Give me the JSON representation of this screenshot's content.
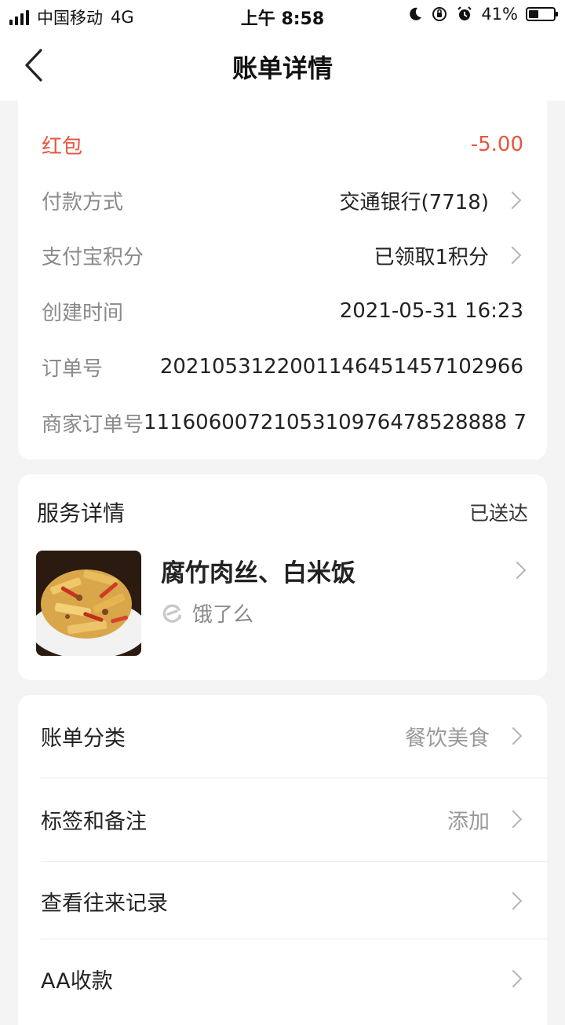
{
  "status_bar": {
    "carrier": "中国移动",
    "network": "4G",
    "time": "上午 8:58",
    "battery": "41%",
    "battery_level": 0.41
  },
  "nav": {
    "title": "账单详情"
  },
  "bill": {
    "type_label": "红包",
    "amount": "-5.00",
    "accent_color": "#e8553e",
    "rows": [
      {
        "label": "付款方式",
        "value": "交通银行(7718)"
      },
      {
        "label": "支付宝积分",
        "value": "已领取1积分"
      },
      {
        "label": "创建时间",
        "value": "2021-05-31 16:23"
      },
      {
        "label": "订单号",
        "value": "2021053122001146451457102966"
      },
      {
        "label": "商家订单号",
        "value": "1116060072105310976478528888 7"
      }
    ]
  },
  "service": {
    "title": "服务详情",
    "status": "已送达",
    "item_name": "腐竹肉丝、白米饭",
    "source": "饿了么",
    "source_icon": "eleme-logo-icon"
  },
  "settings": {
    "items": [
      {
        "label": "账单分类",
        "value": "餐饮美食"
      },
      {
        "label": "标签和备注",
        "value": "添加"
      },
      {
        "label": "查看往来记录",
        "value": ""
      },
      {
        "label": "AA收款",
        "value": ""
      }
    ]
  }
}
